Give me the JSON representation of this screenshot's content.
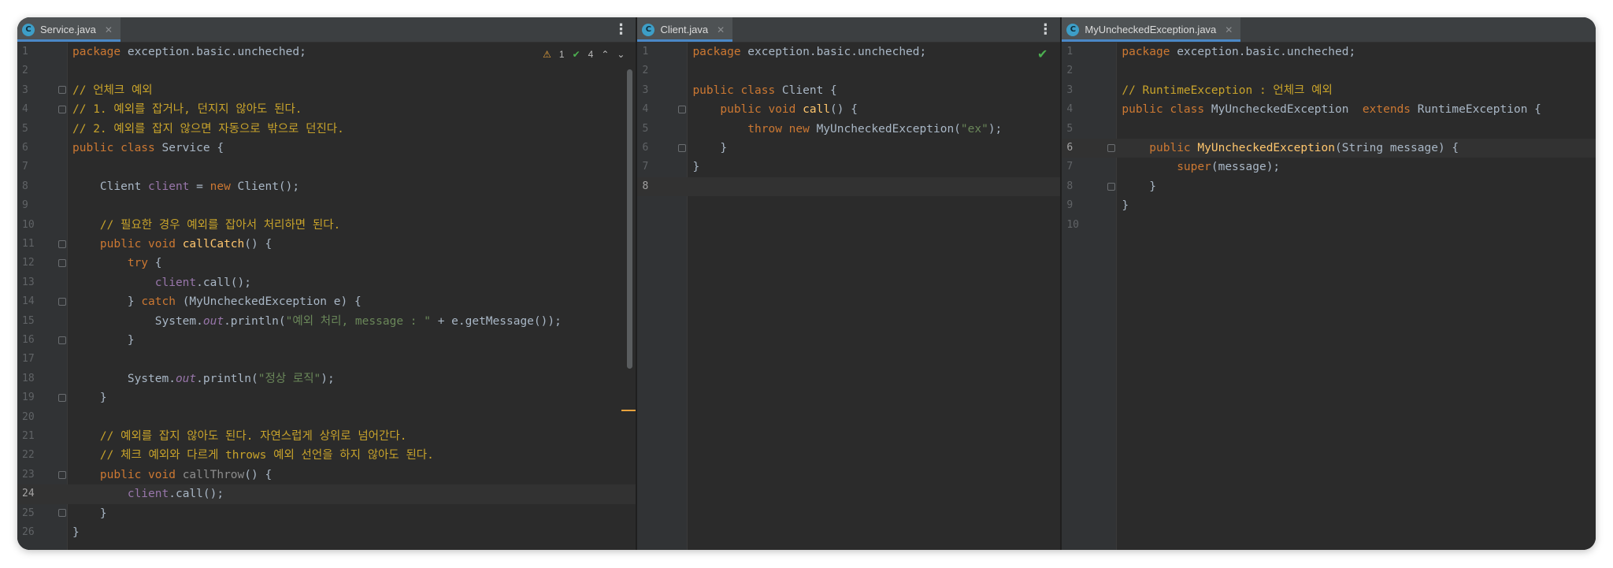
{
  "colors": {
    "background": "#2b2b2b",
    "keyword": "#cc7832",
    "comment": "#c8a32b",
    "string": "#6a8759",
    "field": "#9876aa",
    "method": "#ffc66d",
    "tab_underline": "#4a88c7"
  },
  "panes": [
    {
      "tab": {
        "label": "Service.java",
        "icon": "java-class-icon"
      },
      "inspection": {
        "warnings": "1",
        "checks": "4"
      },
      "current_line": 24,
      "lines": [
        "1",
        "2",
        "3",
        "4",
        "5",
        "6",
        "7",
        "8",
        "9",
        "10",
        "11",
        "12",
        "13",
        "14",
        "15",
        "16",
        "17",
        "18",
        "19",
        "20",
        "21",
        "22",
        "23",
        "24",
        "25",
        "26"
      ]
    },
    {
      "tab": {
        "label": "Client.java",
        "icon": "java-class-icon"
      },
      "current_line": 8,
      "lines": [
        "1",
        "2",
        "3",
        "4",
        "5",
        "6",
        "7",
        "8"
      ]
    },
    {
      "tab": {
        "label": "MyUncheckedException.java",
        "icon": "java-class-icon"
      },
      "current_line": 6,
      "lines": [
        "1",
        "2",
        "3",
        "4",
        "5",
        "6",
        "7",
        "8",
        "9",
        "10"
      ]
    }
  ],
  "code": {
    "service": {
      "l1_kw": "package",
      "l1_rest": " exception.basic.uncheched;",
      "l3": "// 언체크 예외",
      "l4": "// 1. 예외를 잡거나, 던지지 않아도 된다.",
      "l5": "// 2. 예외를 잡지 않으면 자동으로 밖으로 던진다.",
      "l6_kw": "public class",
      "l6_rest": " Service {",
      "l8_a": "    Client ",
      "l8_b": "client",
      "l8_c": " = ",
      "l8_d": "new",
      "l8_e": " Client();",
      "l10": "    // 필요한 경우 예외를 잡아서 처리하면 된다.",
      "l11_kw": "    public void ",
      "l11_fn": "callCatch",
      "l11_rest": "() {",
      "l12_kw": "        try",
      "l12_rest": " {",
      "l13_a": "            ",
      "l13_b": "client",
      "l13_c": ".call();",
      "l14_a": "        } ",
      "l14_kw": "catch",
      "l14_rest": " (MyUncheckedException e) {",
      "l15_a": "            System.",
      "l15_b": "out",
      "l15_c": ".println(",
      "l15_str": "\"예외 처리, message : \"",
      "l15_d": " + e.getMessage());",
      "l16": "        }",
      "l18_a": "        System.",
      "l18_b": "out",
      "l18_c": ".println(",
      "l18_str": "\"정상 로직\"",
      "l18_d": ");",
      "l19": "    }",
      "l21": "    // 예외를 잡지 않아도 된다. 자연스럽게 상위로 넘어간다.",
      "l22": "    // 체크 예외와 다르게 throws 예외 선언을 하지 않아도 된다.",
      "l23_kw": "    public void ",
      "l23_fn": "callThrow",
      "l23_rest": "() {",
      "l24_a": "        ",
      "l24_b": "client",
      "l24_c": ".call();",
      "l25": "    }",
      "l26": "}"
    },
    "client": {
      "l1_kw": "package",
      "l1_rest": " exception.basic.uncheched;",
      "l3_kw": "public class",
      "l3_rest": " Client {",
      "l4_kw": "    public void ",
      "l4_fn": "call",
      "l4_rest": "() {",
      "l5_kw": "        throw new",
      "l5_rest": " MyUncheckedException(",
      "l5_str": "\"ex\"",
      "l5_end": ");",
      "l6": "    }",
      "l7": "}"
    },
    "exception": {
      "l1_kw": "package",
      "l1_rest": " exception.basic.uncheched;",
      "l3": "// RuntimeException : 언체크 예외",
      "l4_kw": "public class",
      "l4_a": " MyUncheckedException  ",
      "l4_kw2": "extends",
      "l4_b": " RuntimeException {",
      "l6_kw": "    public ",
      "l6_fn": "MyUncheckedException",
      "l6_rest": "(String message) {",
      "l7_kw": "        super",
      "l7_rest": "(message);",
      "l8": "    }",
      "l9": "}"
    }
  }
}
